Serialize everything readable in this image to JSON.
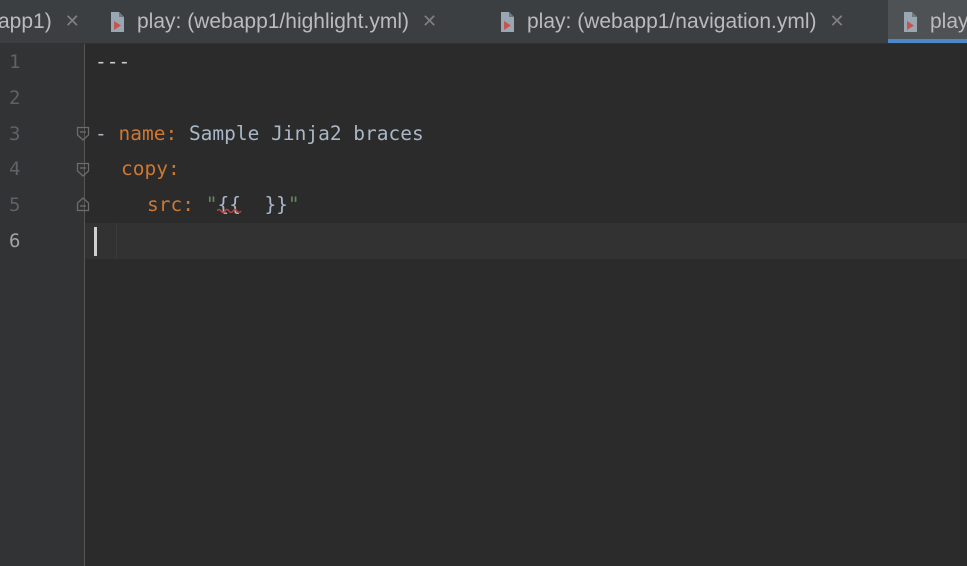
{
  "tabs": [
    {
      "label": "app1)",
      "active": false,
      "has_icon": false,
      "closable": true
    },
    {
      "label": "play: (webapp1/highlight.yml)",
      "active": false,
      "has_icon": true,
      "closable": true
    },
    {
      "label": "play: (webapp1/navigation.yml)",
      "active": false,
      "has_icon": true,
      "closable": true
    },
    {
      "label": "play",
      "active": true,
      "has_icon": true,
      "closable": false
    }
  ],
  "close_glyph": "✕",
  "editor": {
    "line_numbers": [
      "1",
      "2",
      "3",
      "4",
      "5",
      "6"
    ],
    "current_line": 6,
    "lines": {
      "l1": {
        "doc_start": "---"
      },
      "l3": {
        "dash": "- ",
        "key": "name",
        "colon": ": ",
        "value": "Sample Jinja2 braces"
      },
      "l4": {
        "key": "copy",
        "colon": ":"
      },
      "l5": {
        "key": "src",
        "colon": ": ",
        "quote_open": "\"",
        "brace_open": "{{",
        "gap": "  ",
        "brace_close": "}}",
        "quote_close": "\""
      }
    }
  },
  "colors": {
    "background": "#2b2b2b",
    "gutter": "#313335",
    "tabbar": "#3c3f41",
    "active_tab_underline": "#4a88c7",
    "yaml_key": "#cc7832",
    "yaml_value": "#a9b7c6",
    "string": "#6a8759",
    "error_squiggle": "#bc3f3c"
  },
  "icons": {
    "tab_file": "ansible-playbook-file-icon",
    "fold": "fold-marker-icon",
    "close": "close-icon"
  }
}
